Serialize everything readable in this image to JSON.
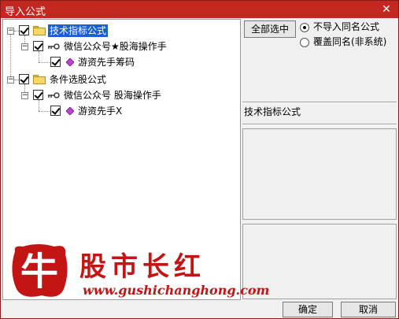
{
  "window": {
    "title": "导入公式",
    "close_glyph": "✕"
  },
  "tree": {
    "nodes": [
      {
        "label": "技术指标公式",
        "expander": "−",
        "checked": true,
        "icon": "folder-icon",
        "selected": true
      },
      {
        "label": "微信公众号★股海操作手",
        "expander": "−",
        "checked": true,
        "icon": "key-icon"
      },
      {
        "label": "游资先手筹码",
        "checked": true,
        "icon": "diamond-icon"
      },
      {
        "label": "条件选股公式",
        "expander": "−",
        "checked": true,
        "icon": "folder-icon"
      },
      {
        "label": "微信公众号 股海操作手",
        "expander": "−",
        "checked": true,
        "icon": "key-icon"
      },
      {
        "label": "游资先手X",
        "checked": true,
        "icon": "diamond-icon"
      }
    ]
  },
  "options": {
    "select_all_label": "全部选中",
    "radio_skip_label": "不导入同名公式",
    "radio_overwrite_label": "覆盖同名(非系统)",
    "selected_option": "skip"
  },
  "section_title": "技术指标公式",
  "watermark": {
    "char": "牛",
    "text": "股市长红",
    "url": "www.gushichanghong.com"
  },
  "footer": {
    "ok_label": "确定",
    "cancel_label": "取消"
  },
  "colors": {
    "titlebar": "#c4271f",
    "selection": "#1a5fd1",
    "watermark": "#c41515"
  }
}
